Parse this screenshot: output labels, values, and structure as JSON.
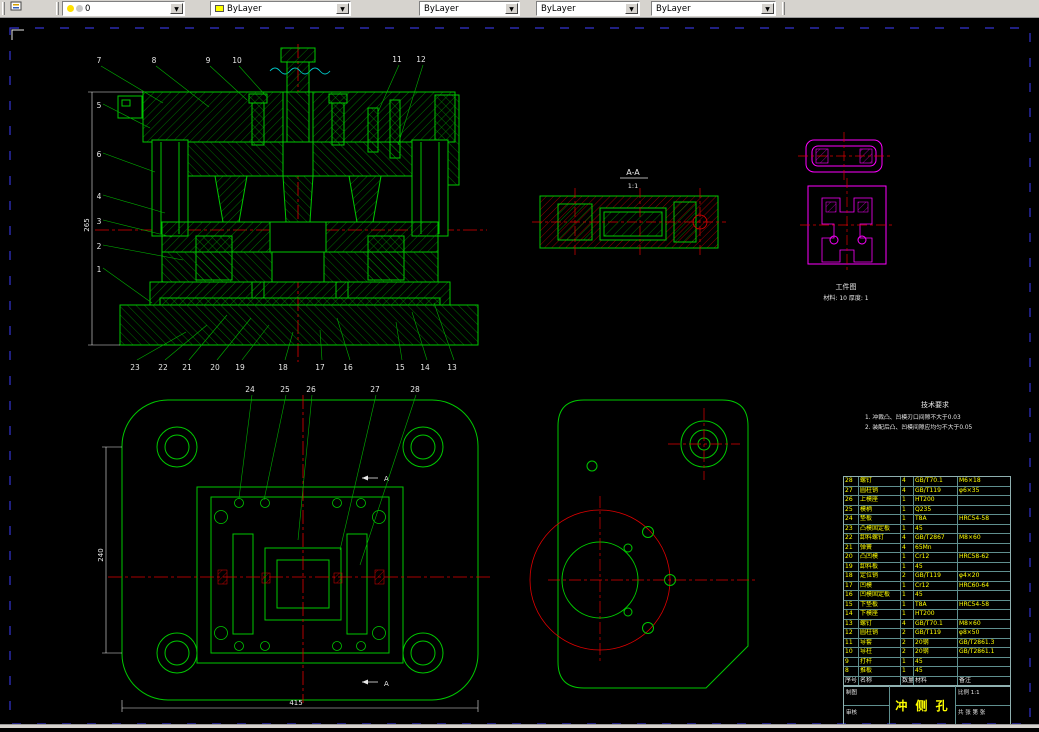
{
  "toolbar": {
    "layer_control": {
      "value": "0"
    },
    "color_control": {
      "value": "ByLayer",
      "swatch_color": "#ffff00"
    },
    "linetype_control": {
      "value": "ByLayer"
    },
    "lineweight_control": {
      "value": "ByLayer"
    },
    "plotstyle_control": {
      "value": "ByLayer"
    },
    "dropdown_glyph": "▼"
  },
  "section_view": {
    "callouts_top": [
      "7",
      "8",
      "9",
      "10",
      "11",
      "12"
    ],
    "callouts_left": [
      "5",
      "6",
      "4",
      "3",
      "2",
      "1"
    ],
    "callouts_bottom": [
      "23",
      "22",
      "21",
      "20",
      "19",
      "18",
      "17",
      "16",
      "15",
      "14",
      "13"
    ],
    "dim_height": "265"
  },
  "aa_view": {
    "label": "A-A",
    "scale": "1:1"
  },
  "workpiece_view": {
    "caption": "工件图",
    "note": "材料: 10   厚度: 1"
  },
  "tech_requirements": {
    "title": "技术要求",
    "line1": "1. 冲裁凸、凹模刃口间隙不大于0.03",
    "line2": "2. 装配后凸、凹模间隙应均匀不大于0.05"
  },
  "plan_view": {
    "callouts": [
      "24",
      "25",
      "26",
      "27",
      "28"
    ],
    "dim_left": "240",
    "dim_bottom": "415",
    "section_mark": "A"
  },
  "parts_table": {
    "headers": [
      "序号",
      "名称",
      "数量",
      "材料",
      "备注"
    ],
    "rows": [
      [
        "28",
        "螺钉",
        "4",
        "GB/T70.1",
        "M6×18"
      ],
      [
        "27",
        "圆柱销",
        "4",
        "GB/T119",
        "φ6×35"
      ],
      [
        "26",
        "上模座",
        "1",
        "HT200",
        ""
      ],
      [
        "25",
        "模柄",
        "1",
        "Q235",
        ""
      ],
      [
        "24",
        "垫板",
        "1",
        "T8A",
        "HRC54-58"
      ],
      [
        "23",
        "凸模固定板",
        "1",
        "45",
        ""
      ],
      [
        "22",
        "卸料螺钉",
        "4",
        "GB/T2867",
        "M8×60"
      ],
      [
        "21",
        "弹簧",
        "4",
        "65Mn",
        ""
      ],
      [
        "20",
        "凸凹模",
        "1",
        "Cr12",
        "HRC58-62"
      ],
      [
        "19",
        "卸料板",
        "1",
        "45",
        ""
      ],
      [
        "18",
        "定位销",
        "2",
        "GB/T119",
        "φ4×20"
      ],
      [
        "17",
        "凹模",
        "1",
        "Cr12",
        "HRC60-64"
      ],
      [
        "16",
        "凹模固定板",
        "1",
        "45",
        ""
      ],
      [
        "15",
        "下垫板",
        "1",
        "T8A",
        "HRC54-58"
      ],
      [
        "14",
        "下模座",
        "1",
        "HT200",
        ""
      ],
      [
        "13",
        "螺钉",
        "4",
        "GB/T70.1",
        "M8×60"
      ],
      [
        "12",
        "圆柱销",
        "2",
        "GB/T119",
        "φ8×50"
      ],
      [
        "11",
        "导套",
        "2",
        "20钢",
        "GB/T2861.3"
      ],
      [
        "10",
        "导柱",
        "2",
        "20钢",
        "GB/T2861.1"
      ],
      [
        "9",
        "打杆",
        "1",
        "45",
        ""
      ],
      [
        "8",
        "推板",
        "1",
        "45",
        ""
      ]
    ]
  },
  "title_block": {
    "title": "冲 侧 孔",
    "left_field_1": "制图",
    "left_field_2": "审核",
    "right_field_1": "比例 1:1",
    "right_field_2": "共 张 第 张"
  }
}
